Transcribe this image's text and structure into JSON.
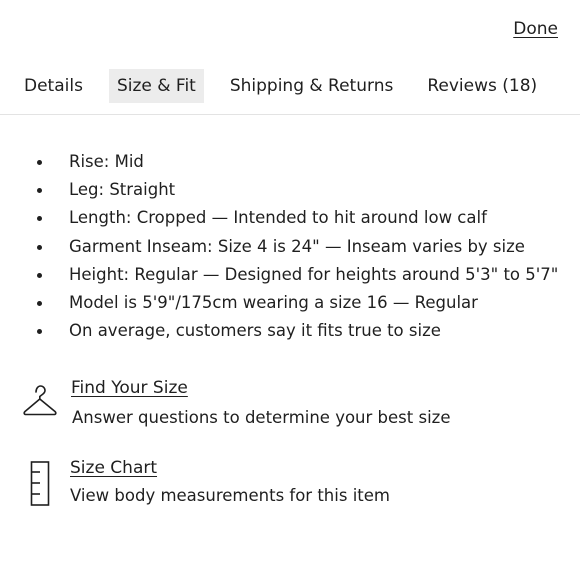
{
  "header": {
    "done_label": "Done"
  },
  "tabs": [
    {
      "label": "Details",
      "active": false
    },
    {
      "label": "Size & Fit",
      "active": true
    },
    {
      "label": "Shipping & Returns",
      "active": false
    },
    {
      "label": "Reviews (18)",
      "active": false
    }
  ],
  "fit_details": [
    "Rise: Mid",
    "Leg: Straight",
    "Length: Cropped — Intended to hit around low calf",
    "Garment Inseam: Size 4 is 24\" — Inseam varies by size",
    "Height: Regular — Designed for heights around 5'3\" to 5'7\"",
    "Model is 5'9\"/175cm wearing a size 16  —  Regular",
    "On average, customers say it fits true to size"
  ],
  "find_your_size": {
    "icon": "hanger-icon",
    "title": "Find Your Size",
    "description": "Answer questions to determine your best size"
  },
  "size_chart": {
    "icon": "ruler-icon",
    "title": "Size Chart",
    "description": "View body measurements for this item"
  }
}
